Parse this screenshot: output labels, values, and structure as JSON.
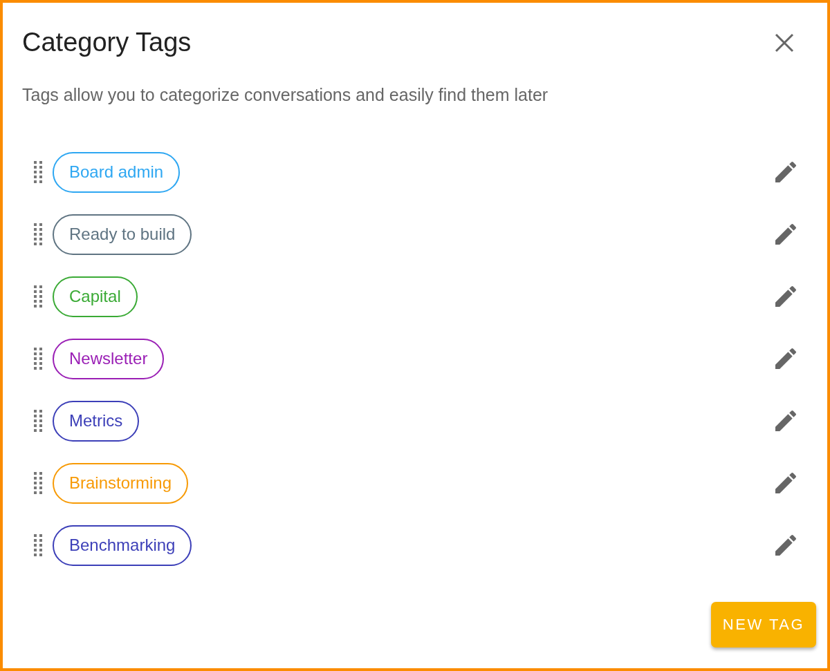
{
  "dialog": {
    "title": "Category Tags",
    "description": "Tags allow you to categorize conversations and easily find them later"
  },
  "tags": [
    {
      "label": "Board admin",
      "color": "#2ea7f2"
    },
    {
      "label": "Ready to build",
      "color": "#5f7482"
    },
    {
      "label": "Capital",
      "color": "#3aaa35"
    },
    {
      "label": "Newsletter",
      "color": "#9a1fb5"
    },
    {
      "label": "Metrics",
      "color": "#3c3fb8"
    },
    {
      "label": "Brainstorming",
      "color": "#f79a05"
    },
    {
      "label": "Benchmarking",
      "color": "#3c3fb8"
    }
  ],
  "new_tag_button": "NEW TAG"
}
